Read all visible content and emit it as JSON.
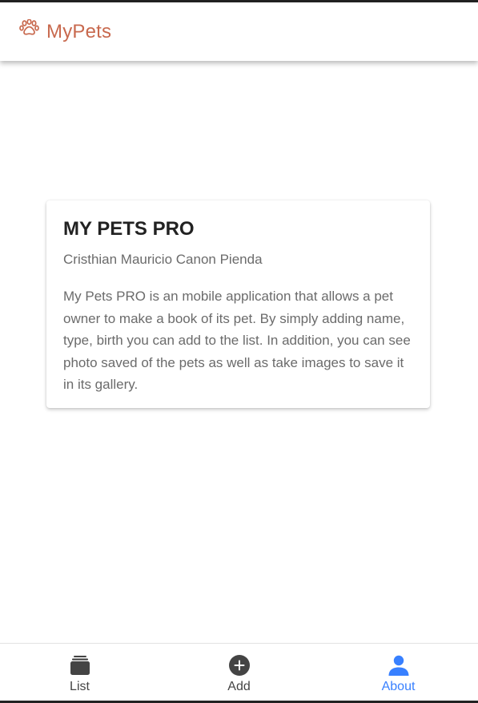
{
  "app": {
    "title": "MyPets",
    "brand_color": "#c8694e",
    "logo_icon": "paw-icon"
  },
  "about_card": {
    "title": "MY PETS PRO",
    "subtitle": "Cristhian Mauricio Canon Pienda",
    "body": "My Pets PRO is an mobile application that allows a pet owner to make a book of its pet. By simply adding name, type, birth you can add to the list. In addition, you can see photo saved of the pets as well as take images to save it in its gallery."
  },
  "tabs": [
    {
      "label": "List",
      "icon": "albums-icon",
      "active": false
    },
    {
      "label": "Add",
      "icon": "add-circle-icon",
      "active": false
    },
    {
      "label": "About",
      "icon": "person-icon",
      "active": true
    }
  ],
  "colors": {
    "active_tab": "#3880ff",
    "inactive_tab": "#444444"
  }
}
